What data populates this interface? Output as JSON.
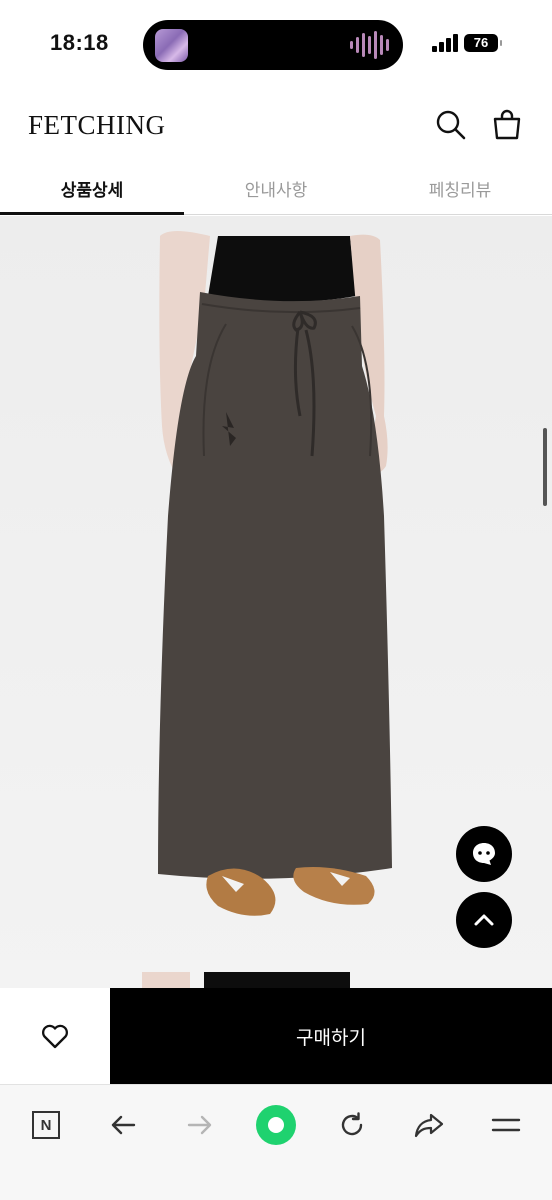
{
  "status_bar": {
    "time": "18:18",
    "battery": "76"
  },
  "header": {
    "logo": "FETCHING"
  },
  "tabs": [
    {
      "label": "상품상세",
      "active": true
    },
    {
      "label": "안내사항",
      "active": false
    },
    {
      "label": "페칭리뷰",
      "active": false
    }
  ],
  "purchase": {
    "buy_label": "구매하기"
  },
  "icons": {
    "search": "search-icon",
    "bag": "shopping-bag-icon",
    "chat": "chat-icon",
    "scroll_top": "chevron-up-icon",
    "wishlist": "heart-icon",
    "browser_home": "naver-n-icon",
    "back": "arrow-left-icon",
    "forward": "arrow-right-icon",
    "green": "green-dot-icon",
    "refresh": "refresh-icon",
    "share": "share-icon",
    "menu": "menu-icon"
  },
  "colors": {
    "accent": "#000000",
    "skirt": "#4a4440",
    "naver_green": "#1fd26f"
  }
}
